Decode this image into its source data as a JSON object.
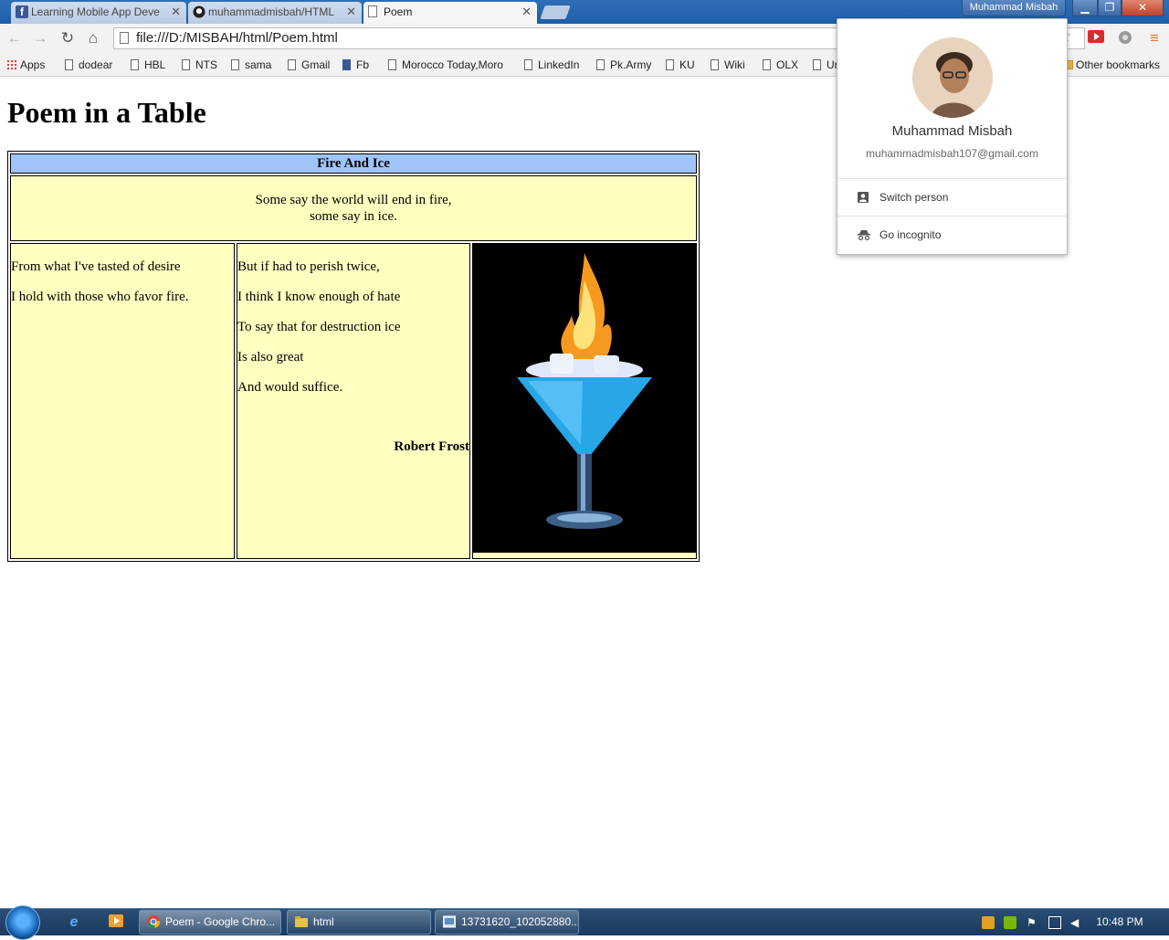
{
  "browser": {
    "tabs": [
      {
        "label": "Learning Mobile App Deve",
        "icon": "facebook-icon",
        "active": false
      },
      {
        "label": "muhammadmisbah/HTML",
        "icon": "github-icon",
        "active": false
      },
      {
        "label": "Poem",
        "icon": "page-icon",
        "active": true
      }
    ],
    "profile_button": "Muhammad Misbah",
    "url": "file:///D:/MISBAH/html/Poem.html",
    "bookmarks": [
      {
        "label": "Apps",
        "icon": "apps-icon"
      },
      {
        "label": "dodear",
        "icon": "page-icon"
      },
      {
        "label": "HBL",
        "icon": "page-icon"
      },
      {
        "label": "NTS",
        "icon": "page-icon"
      },
      {
        "label": "sama",
        "icon": "page-icon"
      },
      {
        "label": "Gmail",
        "icon": "page-icon"
      },
      {
        "label": "Fb",
        "icon": "facebook-icon"
      },
      {
        "label": "Morocco Today,Moro",
        "icon": "page-icon"
      },
      {
        "label": "LinkedIn",
        "icon": "page-icon"
      },
      {
        "label": "Pk.Army",
        "icon": "page-icon"
      },
      {
        "label": "KU",
        "icon": "page-icon"
      },
      {
        "label": "Wiki",
        "icon": "page-icon"
      },
      {
        "label": "OLX",
        "icon": "page-icon"
      },
      {
        "label": "Ur",
        "icon": "page-icon"
      }
    ],
    "other_bookmarks": "Other bookmarks"
  },
  "profile_popup": {
    "name": "Muhammad Misbah",
    "email": "muhammadmisbah107@gmail.com",
    "switch_person": "Switch person",
    "go_incognito": "Go incognito"
  },
  "page": {
    "title": "Poem in a Table",
    "poem_title": "Fire And Ice",
    "intro_line1": "Some say the world will end in fire,",
    "intro_line2": "some say in ice.",
    "left_lines": [
      "From what I've tasted of desire",
      "I hold with those who favor fire."
    ],
    "middle_lines": [
      "But if had to perish twice,",
      "I think I know enough of hate",
      "To say that for destruction ice",
      "Is also great",
      "And would suffice."
    ],
    "author": "Robert Frost",
    "image": "flaming-blue-cocktail-image"
  },
  "taskbar": {
    "items": [
      {
        "label": "Poem - Google Chro...",
        "icon": "chrome-icon"
      },
      {
        "label": "html",
        "icon": "folder-icon"
      },
      {
        "label": "13731620_102052880...",
        "icon": "image-viewer-icon"
      }
    ],
    "clock": "10:48 PM"
  }
}
